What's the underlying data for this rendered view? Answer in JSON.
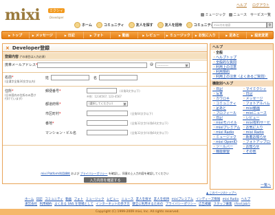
{
  "header": {
    "logo": "mixi",
    "logo_sub": "ミクシィ",
    "logo_tag": "Developer",
    "top_links": [
      "ヘルプ",
      "ログアウト"
    ],
    "util_links": [
      "ミュージック",
      "ニュース",
      "サービス一覧"
    ],
    "icon_nav": [
      "ホーム",
      "コミュニティ",
      "友人を探す",
      "友人を招待",
      "コミュニティ"
    ],
    "search_placeholder": "mixi内を検索"
  },
  "menu": [
    "トップ",
    "メッセージ",
    "日記",
    "フォト",
    "動画",
    "レビュー",
    "ミュージック",
    "お気に入り",
    "足あと",
    "設定変更"
  ],
  "form": {
    "title": "Developer登録",
    "section_head": "登録内容",
    "section_note": "(*の項目は入力必須)",
    "email_label": "携帯メールアドレス",
    "email_at": "@",
    "email_domain": "-----------",
    "name_label": "名前",
    "name_sub": "(全漢字全角30文字以内)",
    "last_name_label": "姓",
    "first_name_label": "名",
    "address_label": "住所",
    "address_sub": "(日本国内の住所のみ受け付けています)",
    "zip_label": "郵便番号",
    "zip_hint": "(半角8文字以下)",
    "zip_example": "※例：1234567, 123-4567",
    "pref_label": "都道府県",
    "pref_value": "(選択してください)",
    "city_label": "市区町村",
    "city_hint": "(全角64文字以下)",
    "street_label": "番地",
    "street_hint": "(全角32文字/半角64文字以下)",
    "building_label": "マンション・ビル名",
    "building_hint": "(全角32文字/半角64文字以下)",
    "agree_text": "mixi Platform利用規約およびプライバシーポリシーを確認し、同意の上入力内容を確認してください",
    "agree_link1": "mixi Platform利用規約",
    "agree_link2": "プライバシーポリシー",
    "submit": "入力内容を確認する"
  },
  "sidebar": {
    "help_head": "ヘルプ",
    "help_sub": "全般",
    "help_items": [
      "ヘルプトップ",
      "全般的な質問",
      "利用上の注意",
      "利用規約",
      "利用上の注意（よくあるご質問）"
    ],
    "func_head": "機能別ヘルプ",
    "func_items": [
      "日記",
      "マイミクシィ",
      "写真",
      "日記",
      "カウロキ",
      "メッセージ",
      "コミュニティ",
      "フォトアルバム",
      "足あと",
      "mixi動画",
      "プロフィール",
      "mixiニュース",
      "日記",
      "レビュー",
      "mixiモバイル",
      "mixi有料サービス",
      "mixiプレミアム",
      "お気に入り",
      "mixi Radio",
      "mixi Radio",
      "ミュージック",
      "新着お知らせ",
      "mixi OpenID",
      "フォトアップローダー",
      "ツールバー",
      "お知らせ",
      "機能要望",
      "その他"
    ],
    "more": "一覧へ",
    "latest": "▲ このページのトップへ"
  },
  "footer": {
    "line1": [
      "ホーム",
      "日記",
      "コミュニティ",
      "動画",
      "フォト",
      "ミュージック",
      "レビュー",
      "ニュース",
      "友人を探す",
      "友人を招待",
      "mixiプレミアム",
      "インディーズ情報",
      "mixi Radio",
      "ヘルプ"
    ],
    "line2": [
      "運営会社",
      "利用規約",
      "よくある SNS を現場として",
      "インターネットの歩き方",
      "健全に利用するための",
      "プライバシーポリシー",
      "広告掲載",
      "スタッフ募集",
      "(Find Job!)"
    ],
    "copyright": "Copyright (C) 1999-2009 mixi, Inc. All rights reserved."
  }
}
